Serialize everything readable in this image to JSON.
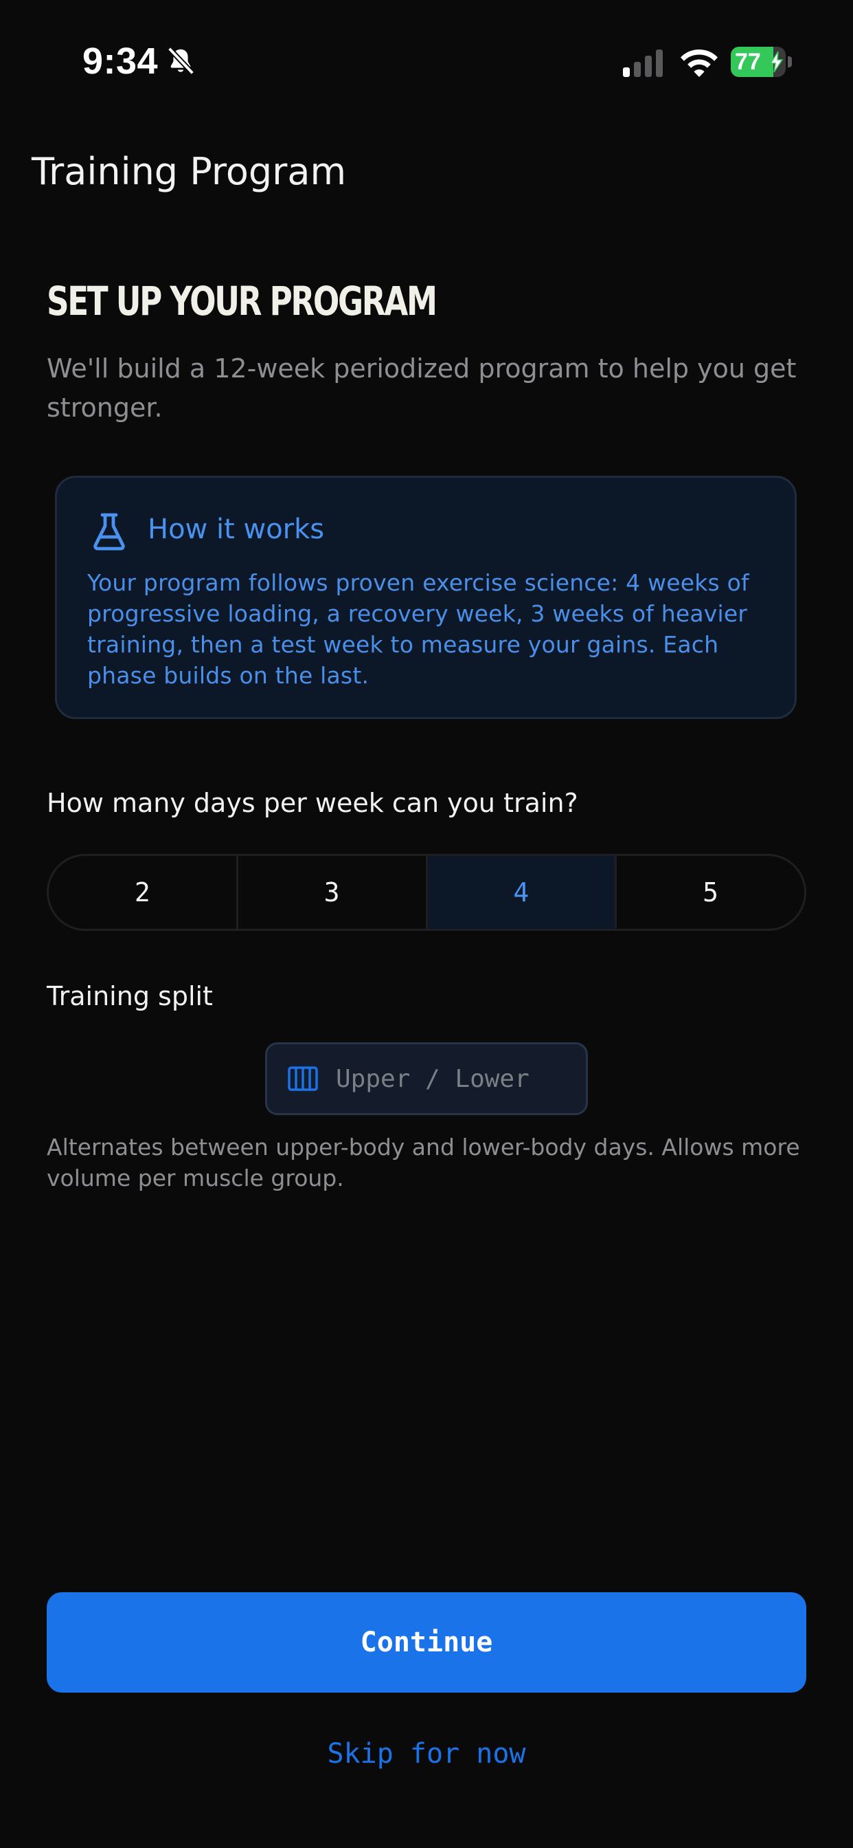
{
  "status_bar": {
    "time": "9:34",
    "battery_percent": "77",
    "battery_level": 0.77
  },
  "header": {
    "title": "Training Program"
  },
  "setup": {
    "heading": "SET UP YOUR PROGRAM",
    "intro": "We'll build a 12-week periodized program to help you get stronger."
  },
  "info_card": {
    "title": "How it works",
    "body": "Your program follows proven exercise science: 4 weeks of progressive loading, a recovery week, 3 weeks of heavier training, then a test week to measure your gains. Each phase builds on the last."
  },
  "days": {
    "question": "How many days per week can you train?",
    "options": [
      "2",
      "3",
      "4",
      "5"
    ],
    "selected": "4"
  },
  "split": {
    "label": "Training split",
    "value": "Upper / Lower",
    "description": "Alternates between upper-body and lower-body days. Allows more volume per muscle group."
  },
  "actions": {
    "continue_label": "Continue",
    "skip_label": "Skip for now"
  },
  "colors": {
    "accent": "#1a73e8",
    "accent_text": "#4a92f0",
    "background": "#0a0a0a",
    "card_bg": "#0c1828",
    "battery": "#34c759"
  },
  "icons": {
    "status": [
      "bell-slash-icon",
      "cellular-signal-icon",
      "wifi-icon",
      "battery-icon",
      "charging-bolt-icon"
    ],
    "info": "flask-icon",
    "split": "columns-icon"
  }
}
